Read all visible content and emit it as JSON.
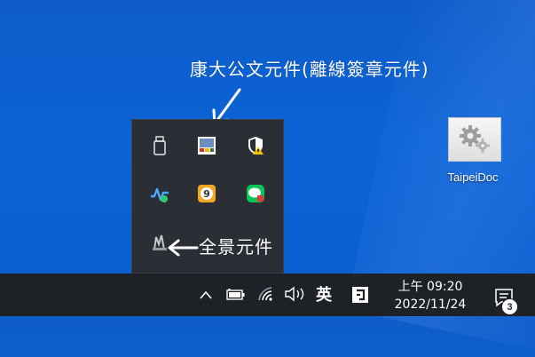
{
  "annotations": {
    "top_label": "康大公文元件(離線簽章元件)",
    "bottom_label": "全景元件"
  },
  "tray_popup": {
    "icons": [
      "usb-drive-icon",
      "kangda-signature-icon",
      "windows-security-warning-icon",
      "health-monitor-icon",
      "nine-badge-app-icon",
      "line-chat-icon",
      "chunghwa-card-component-icon"
    ]
  },
  "desktop": {
    "icons": [
      {
        "label": "TaipeiDoc",
        "icon": "gears-icon"
      }
    ]
  },
  "taskbar": {
    "ime_label": "英",
    "clock": {
      "time": "上午 09:20",
      "date": "2022/11/24"
    },
    "notification_count": "3"
  },
  "colors": {
    "desktop_blue": "#0b63d6",
    "taskbar": "#1e2226",
    "popup": "#2b2f35"
  }
}
